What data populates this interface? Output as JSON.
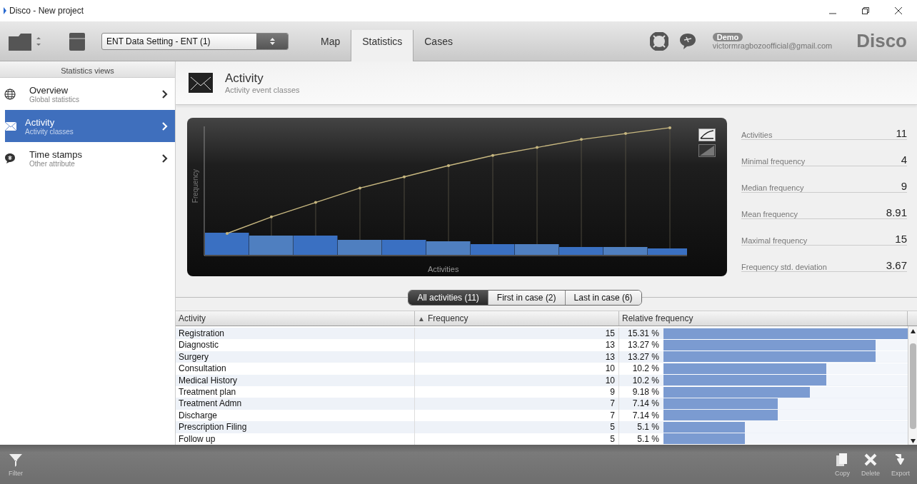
{
  "window": {
    "title": "Disco - New project"
  },
  "toolbar": {
    "dataset": "ENT Data Setting - ENT (1)",
    "tabs": [
      {
        "label": "Map",
        "selected": false
      },
      {
        "label": "Statistics",
        "selected": true
      },
      {
        "label": "Cases",
        "selected": false
      }
    ],
    "account": {
      "badge": "Demo",
      "email": "victormragbozoofficial@gmail.com"
    },
    "logo": "Disco"
  },
  "sidebar": {
    "heading": "Statistics views",
    "items": [
      {
        "title": "Overview",
        "subtitle": "Global statistics",
        "selected": false
      },
      {
        "title": "Activity",
        "subtitle": "Activity classes",
        "selected": true
      },
      {
        "title": "Time stamps",
        "subtitle": "Other attribute",
        "selected": false
      }
    ]
  },
  "header": {
    "title": "Activity",
    "subtitle": "Activity event classes"
  },
  "chart": {
    "ylabel": "Frequency",
    "xlabel": "Activities"
  },
  "stats": [
    {
      "label": "Activities",
      "value": "11"
    },
    {
      "label": "Minimal frequency",
      "value": "4"
    },
    {
      "label": "Median frequency",
      "value": "9"
    },
    {
      "label": "Mean frequency",
      "value": "8.91"
    },
    {
      "label": "Maximal frequency",
      "value": "15"
    },
    {
      "label": "Frequency std. deviation",
      "value": "3.67"
    }
  ],
  "filter_tabs": [
    {
      "label": "All activities (11)",
      "selected": true
    },
    {
      "label": "First in case (2)",
      "selected": false
    },
    {
      "label": "Last in case (6)",
      "selected": false
    }
  ],
  "table": {
    "columns": [
      {
        "label": "Activity"
      },
      {
        "label": "Frequency",
        "sort_mark": "▲"
      },
      {
        "label": "Relative frequency"
      }
    ],
    "rows": [
      {
        "activity": "Registration",
        "frequency": "15",
        "relative": "15.31 %",
        "level": 1
      },
      {
        "activity": "Diagnostic",
        "frequency": "13",
        "relative": "13.27 %",
        "level": 0.867
      },
      {
        "activity": "Surgery",
        "frequency": "13",
        "relative": "13.27 %",
        "level": 0.867
      },
      {
        "activity": "Consultation",
        "frequency": "10",
        "relative": "10.2 %",
        "level": 0.667
      },
      {
        "activity": "Medical History",
        "frequency": "10",
        "relative": "10.2 %",
        "level": 0.667
      },
      {
        "activity": "Treatment plan",
        "frequency": "9",
        "relative": "9.18 %",
        "level": 0.6
      },
      {
        "activity": "Treatment Admn",
        "frequency": "7",
        "relative": "7.14 %",
        "level": 0.467
      },
      {
        "activity": "Discharge",
        "frequency": "7",
        "relative": "7.14 %",
        "level": 0.467
      },
      {
        "activity": "Prescription Filing",
        "frequency": "5",
        "relative": "5.1 %",
        "level": 0.333
      },
      {
        "activity": "Follow up",
        "frequency": "5",
        "relative": "5.1 %",
        "level": 0.333
      }
    ]
  },
  "bottom_bar": {
    "left": [
      {
        "label": "Filter"
      }
    ],
    "right": [
      {
        "label": "Copy"
      },
      {
        "label": "Delete"
      },
      {
        "label": "Export"
      }
    ]
  }
}
